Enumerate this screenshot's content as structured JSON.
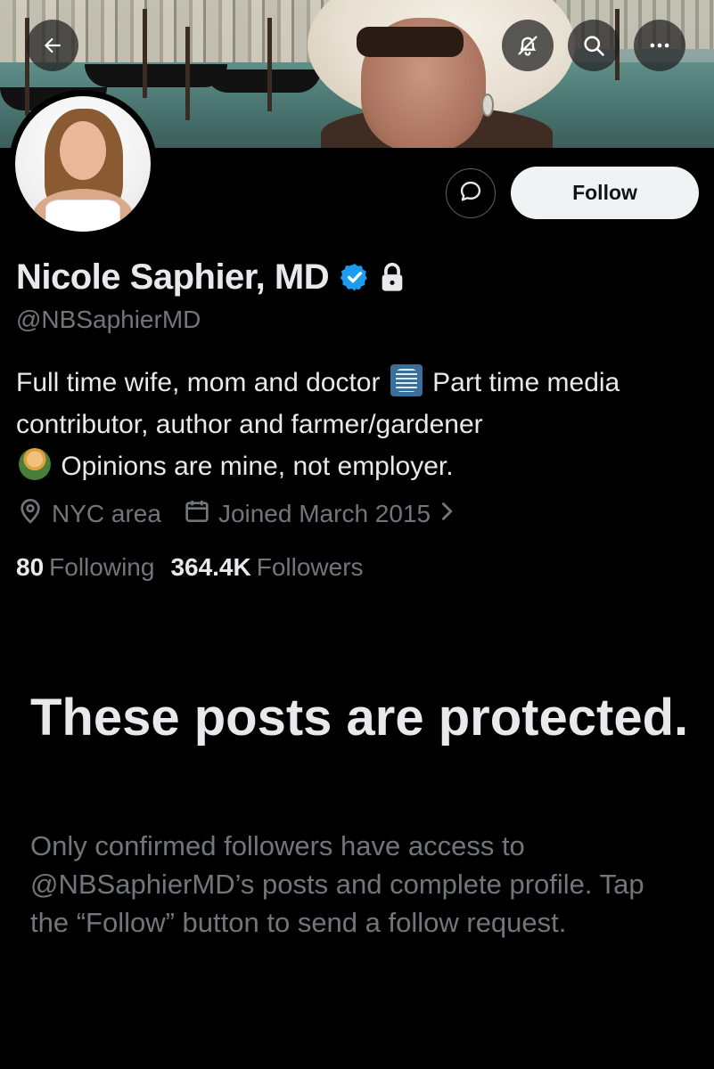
{
  "header": {
    "back_icon": "arrow-left-icon",
    "mute_icon": "bell-slash-icon",
    "search_icon": "search-icon",
    "more_icon": "ellipsis-icon"
  },
  "profile": {
    "name": "Nicole Saphier, MD",
    "handle": "@NBSaphierMD",
    "verified": true,
    "protected": true,
    "bio": {
      "part1": "Full time wife, mom and doctor",
      "part2": "Part time media contributor, author and farmer/gardener",
      "part3": "Opinions are mine, not employer."
    },
    "location": "NYC area",
    "joined": "Joined March 2015",
    "following_count": "80",
    "following_label": "Following",
    "followers_count": "364.4K",
    "followers_label": "Followers"
  },
  "actions": {
    "follow_label": "Follow",
    "message_icon": "chat-bubble-icon"
  },
  "notice": {
    "title": "These posts are protected.",
    "body": "Only confirmed followers have access to @NBSaphierMD’s posts and complete profile. Tap the “Follow” button to send a follow request."
  },
  "colors": {
    "background": "#000000",
    "text_primary": "#e7e9ea",
    "text_secondary": "#71767b",
    "verified_blue": "#1d9bf0",
    "follow_button_bg": "#eff3f4"
  }
}
